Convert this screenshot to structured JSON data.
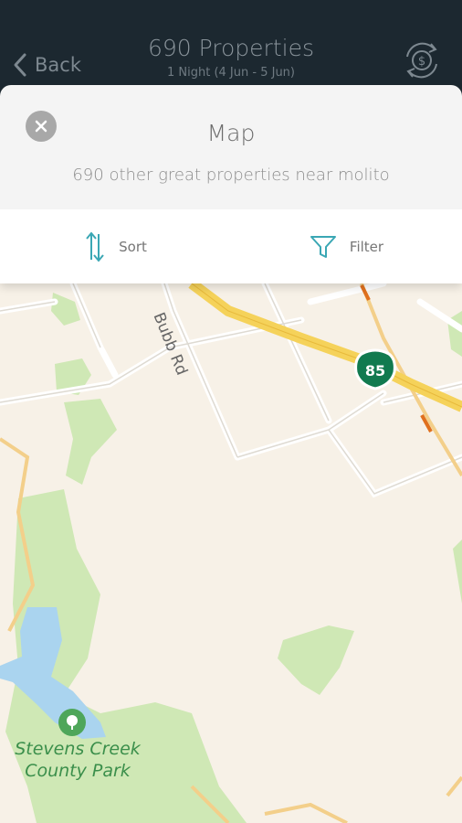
{
  "header": {
    "back_label": "Back",
    "title": "690 Properties",
    "subtitle": "1 Night (4 Jun - 5 Jun)",
    "currency_icon": "dollar-cycle-icon"
  },
  "sheet": {
    "title": "Map",
    "subtitle": "690 other great properties near molito",
    "close_icon": "close-icon"
  },
  "toolbar": {
    "sort_label": "Sort",
    "filter_label": "Filter",
    "sort_icon": "sort-arrows-icon",
    "filter_icon": "funnel-icon"
  },
  "map": {
    "road_label": "Bubb Rd",
    "highway_number": "85",
    "park_name_line1": "Stevens Creek",
    "park_name_line2": "County Park",
    "colors": {
      "land": "#f7f1e7",
      "park": "#cfe8b5",
      "water": "#aad4ef",
      "highway": "#f5d25a",
      "shield": "#117a4f",
      "park_label": "#3b8f4b"
    }
  }
}
